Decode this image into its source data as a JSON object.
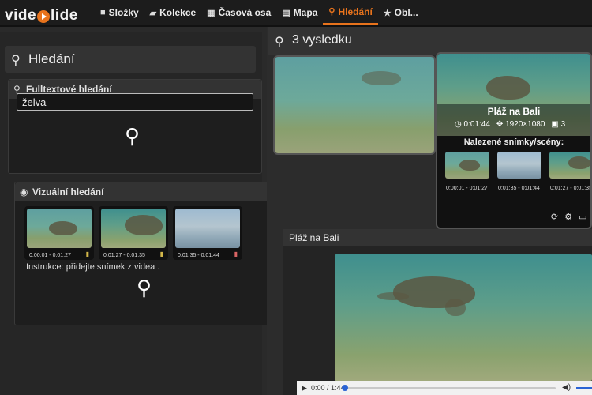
{
  "app": {
    "logo_text_left": "vide",
    "logo_text_right": "lide"
  },
  "nav": {
    "items": [
      {
        "label": "Složky",
        "icon": "folder-icon"
      },
      {
        "label": "Kolekce",
        "icon": "book-icon"
      },
      {
        "label": "Časová osa",
        "icon": "calendar-icon"
      },
      {
        "label": "Mapa",
        "icon": "map-icon"
      },
      {
        "label": "Hledání",
        "icon": "search-icon",
        "active": true
      },
      {
        "label": "Obl...",
        "icon": "star-icon"
      }
    ],
    "accent_color": "#e8731c"
  },
  "search": {
    "title": "Hledání",
    "fulltext": {
      "title": "Fulltextové hledání",
      "value": "želva"
    },
    "visual": {
      "title": "Vizuální hledání",
      "thumbs": [
        {
          "time": "0:00:01 - 0:01:27"
        },
        {
          "time": "0:01:27 - 0:01:35"
        },
        {
          "time": "0:01:35 - 0:01:44"
        }
      ],
      "instructions": "Instrukce: přidejte snímek z videa ."
    }
  },
  "results": {
    "count_label": "3 vysledku",
    "featured": {
      "title": "Pláž na Bali",
      "duration": "0:01:44",
      "resolution": "1920×1080",
      "scenes_count": "3",
      "found_label": "Nalezené snímky/scény:",
      "scenes": [
        {
          "time": "0:00:01 - 0:01:27"
        },
        {
          "time": "0:01:35 - 0:01:44"
        },
        {
          "time": "0:01:27 - 0:01:35"
        }
      ]
    }
  },
  "player": {
    "title": "Pláž na Bali",
    "time": "0:00 / 1:44",
    "progress": 0.0
  }
}
